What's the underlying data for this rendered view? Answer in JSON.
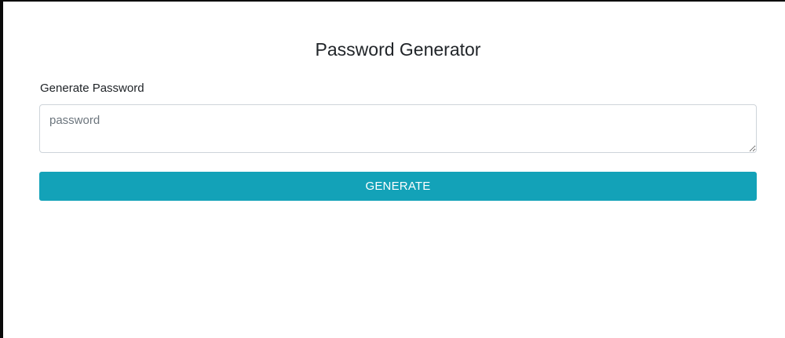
{
  "header": {
    "title": "Password Generator"
  },
  "form": {
    "label": "Generate Password",
    "password": {
      "value": "",
      "placeholder": "password"
    },
    "generate_label": "GENERATE"
  },
  "colors": {
    "button_bg": "#13a2b8",
    "button_text": "#ffffff",
    "text": "#212529",
    "border": "#ced4da"
  }
}
